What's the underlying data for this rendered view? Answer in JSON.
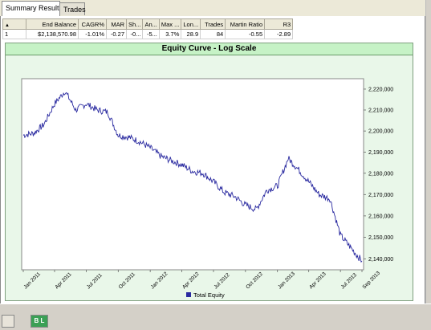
{
  "tabs": [
    {
      "label": "Summary Results",
      "active": true
    },
    {
      "label": "Trades",
      "active": false
    }
  ],
  "table": {
    "sort_glyph": "▲",
    "columns": [
      "",
      "End Balance",
      "CAGR%",
      "MAR",
      "Sh...",
      "An...",
      "Max ...",
      "Lon...",
      "Trades",
      "Martin Ratio",
      "R3"
    ],
    "rows": [
      [
        "1",
        "$2,138,570.98",
        "-1.01%",
        "-0.27",
        "-0...",
        "-5...",
        "3.7%",
        "28.9",
        "84",
        "-0.55",
        "-2.89"
      ]
    ]
  },
  "chart": {
    "title": "Equity Curve - Log Scale",
    "legend": "Total Equity",
    "series_color": "#2a2aa0"
  },
  "chart_data": {
    "type": "line",
    "title": "Equity Curve - Log Scale",
    "log_scale_y": true,
    "grid": false,
    "legend_position": "bottom",
    "ylim": [
      2135000,
      2225000
    ],
    "x_ticks": [
      "Jan 2011",
      "Apr 2011",
      "Jul 2011",
      "Oct 2011",
      "Jan 2012",
      "Apr 2012",
      "Jul 2012",
      "Oct 2012",
      "Jan 2013",
      "Apr 2013",
      "Jul 2013",
      "Sep 2013"
    ],
    "y_ticks": [
      "2,220,000",
      "2,210,000",
      "2,200,000",
      "2,190,000",
      "2,180,000",
      "2,170,000",
      "2,160,000",
      "2,150,000",
      "2,140,000"
    ],
    "series": [
      {
        "name": "Total Equity",
        "x": [
          "2011-01-01",
          "2011-02-01",
          "2011-03-01",
          "2011-04-01",
          "2011-05-01",
          "2011-06-01",
          "2011-07-01",
          "2011-08-01",
          "2011-09-01",
          "2011-10-01",
          "2011-11-01",
          "2011-12-01",
          "2012-01-01",
          "2012-02-01",
          "2012-03-01",
          "2012-04-01",
          "2012-05-01",
          "2012-06-01",
          "2012-07-01",
          "2012-08-01",
          "2012-09-01",
          "2012-10-01",
          "2012-11-01",
          "2012-12-01",
          "2013-01-01",
          "2013-02-01",
          "2013-03-01",
          "2013-04-01",
          "2013-05-01",
          "2013-06-01",
          "2013-07-01",
          "2013-08-01",
          "2013-09-01"
        ],
        "y": [
          2198000,
          2199000,
          2203000,
          2213000,
          2219000,
          2210000,
          2213000,
          2210000,
          2209000,
          2198000,
          2197000,
          2195000,
          2192000,
          2188000,
          2186000,
          2184000,
          2181000,
          2180000,
          2176000,
          2171000,
          2169000,
          2165000,
          2163000,
          2172000,
          2174000,
          2187000,
          2182000,
          2176000,
          2170000,
          2168000,
          2151000,
          2145000,
          2139000
        ]
      }
    ]
  },
  "bottom_bar": {
    "button_1": "",
    "button_2": "B L"
  }
}
